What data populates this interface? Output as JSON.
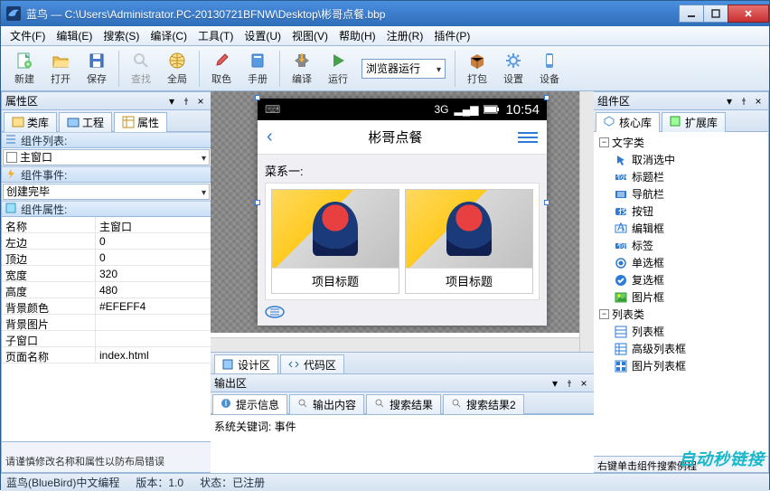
{
  "window": {
    "title": "蓝鸟 — C:\\Users\\Administrator.PC-20130721BFNW\\Desktop\\彬哥点餐.bbp"
  },
  "menu": [
    "文件(F)",
    "编辑(E)",
    "搜索(S)",
    "编译(C)",
    "工具(T)",
    "设置(U)",
    "视图(V)",
    "帮助(H)",
    "注册(R)",
    "插件(P)"
  ],
  "toolbar": {
    "new": "新建",
    "open": "打开",
    "save": "保存",
    "find": "查找",
    "global": "全局",
    "pick": "取色",
    "manual": "手册",
    "compile": "编译",
    "run": "运行",
    "combo_label": "浏览器运行",
    "pack": "打包",
    "settings": "设置",
    "device": "设备"
  },
  "left": {
    "title": "属性区",
    "tabs": {
      "class": "类库",
      "project": "工程",
      "props": "属性"
    },
    "section_list": "组件列表:",
    "list_value": "主窗口",
    "section_event": "组件事件:",
    "event_value": "创建完毕",
    "section_prop": "组件属性:",
    "rows": [
      {
        "k": "名称",
        "v": "主窗口"
      },
      {
        "k": "左边",
        "v": "0"
      },
      {
        "k": "顶边",
        "v": "0"
      },
      {
        "k": "宽度",
        "v": "320"
      },
      {
        "k": "高度",
        "v": "480"
      },
      {
        "k": "背景颜色",
        "v": "#EFEFF4"
      },
      {
        "k": "背景图片",
        "v": ""
      },
      {
        "k": "子窗口",
        "v": ""
      },
      {
        "k": "页面名称",
        "v": "index.html"
      }
    ],
    "hint": "请谨慎修改名称和属性以防布局错误"
  },
  "center": {
    "phone": {
      "status_3g": "3G",
      "status_time": "10:54",
      "nav_title": "彬哥点餐",
      "category": "菜系一:",
      "card_caption": "项目标题"
    },
    "tab_design": "设计区",
    "tab_code": "代码区",
    "output": {
      "title": "输出区",
      "tabs": [
        "提示信息",
        "输出内容",
        "搜索结果",
        "搜索结果2"
      ],
      "text": "系统关键词: 事件"
    }
  },
  "right": {
    "title": "组件区",
    "tab_core": "核心库",
    "tab_ext": "扩展库",
    "groups": {
      "text": "文字类",
      "list": "列表类"
    },
    "text_items": [
      "取消选中",
      "标题栏",
      "导航栏",
      "按钮",
      "编辑框",
      "标签",
      "单选框",
      "复选框",
      "图片框"
    ],
    "list_items": [
      "列表框",
      "高级列表框",
      "图片列表框"
    ],
    "hint": "右键单击组件搜索例程"
  },
  "status": {
    "app": "蓝鸟(BlueBird)中文编程",
    "ver_label": "版本：",
    "ver": "1.0",
    "state_label": "状态：",
    "state": "已注册"
  },
  "watermark": "自动秒链接"
}
